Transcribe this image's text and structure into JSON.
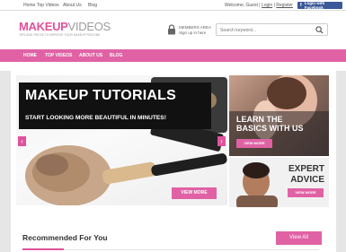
{
  "topbar": {
    "links": [
      "Home",
      "Top Videos",
      "About Us",
      "Blog"
    ],
    "welcome_prefix": "Welcome, Guest |",
    "login": "Login",
    "separator": "|",
    "register": "Register",
    "facebook_button": "Login with Facebook"
  },
  "header": {
    "logo_main": "MAKEUP",
    "logo_accent": "VIDEOS",
    "tagline": "TIPS AND TRICKS TO IMPROVE YOUR MAKEUP ROUTINE",
    "members_title": "MEMBERS AREA",
    "members_link": "Sign up in here",
    "search_placeholder": "Search keyword..."
  },
  "nav": {
    "items": [
      "HOME",
      "TOP VIDEOS",
      "ABOUT US",
      "BLOG"
    ]
  },
  "slider": {
    "title": "MAKEUP TUTORIALS",
    "subtitle": "START LOOKING MORE BEAUTIFUL IN MINUTES!",
    "button": "VIEW MORE",
    "prev": "‹",
    "next": "›"
  },
  "panels": [
    {
      "line1": "LEARN THE",
      "line2": "BASICS WITH US",
      "button": "VIEW MORE"
    },
    {
      "line1": "EXPERT",
      "line2": "ADVICE",
      "button": "VIEW MORE"
    }
  ],
  "recommended": {
    "title": "Recommended For You",
    "button": "View All"
  },
  "colors": {
    "accent": "#e062a5",
    "facebook": "#3b5998"
  }
}
